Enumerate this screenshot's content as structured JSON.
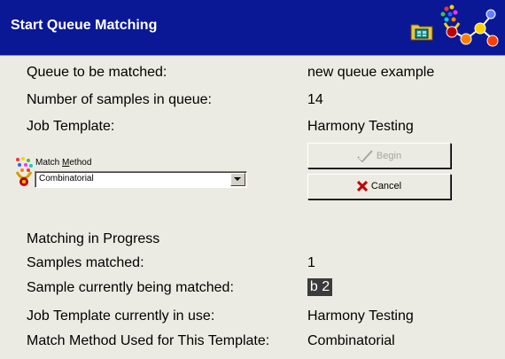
{
  "window": {
    "title": "Start Queue Matching"
  },
  "info": {
    "queue_label": "Queue to be matched:",
    "queue_value": "new queue example",
    "samples_label": "Number of samples in queue:",
    "samples_value": "14",
    "template_label": "Job Template:",
    "template_value": "Harmony Testing"
  },
  "match_method": {
    "label_prefix": "Match ",
    "label_underlined": "M",
    "label_suffix": "ethod",
    "selected": "Combinatorial"
  },
  "buttons": {
    "begin_label": "Begin",
    "cancel_label": "Cancel",
    "cancel_icon_color": "#c00000"
  },
  "progress": {
    "heading": "Matching in Progress",
    "matched_label": "Samples matched:",
    "matched_value": "1",
    "current_label": "Sample currently being matched:",
    "current_value": "b 2",
    "template_label": "Job Template currently in use:",
    "template_value": "Harmony Testing",
    "method_label": "Match Method Used for This Template:",
    "method_value": "Combinatorial"
  },
  "colors": {
    "title_bar": "#0a1896",
    "background": "#ecebe3"
  },
  "icons": [
    "folder-icon",
    "molecule-icon",
    "match-method-icon",
    "checkmark-icon",
    "x-icon",
    "chevron-down-icon"
  ]
}
